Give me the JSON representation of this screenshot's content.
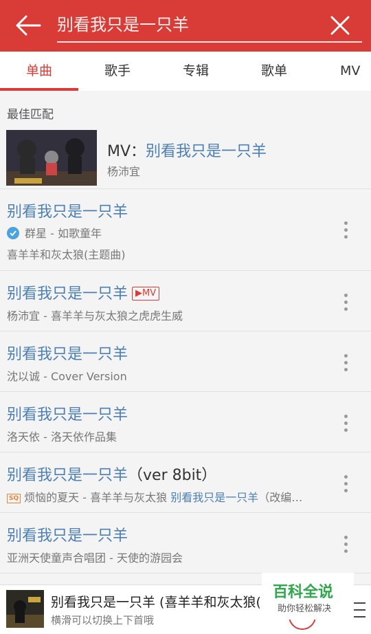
{
  "search": {
    "value": "",
    "placeholder": "别看我只是一只羊"
  },
  "tabs": [
    {
      "label": "单曲",
      "active": true
    },
    {
      "label": "歌手",
      "active": false
    },
    {
      "label": "专辑",
      "active": false
    },
    {
      "label": "歌单",
      "active": false
    },
    {
      "label": "MV",
      "active": false
    }
  ],
  "best_match": {
    "section_title": "最佳匹配",
    "prefix": "MV：",
    "title": "别看我只是一只羊",
    "artist": "杨沛宜"
  },
  "songs": [
    {
      "title": "别看我只是一只羊",
      "line1_prefix": "群星 - ",
      "line1": "如歌童年",
      "line2": "喜羊羊和灰太狼(主题曲)"
    },
    {
      "title": "别看我只是一只羊",
      "badge": "▶MV",
      "sub": "杨沛宜 - 喜羊羊与灰太狼之虎虎生威"
    },
    {
      "title": "别看我只是一只羊",
      "sub": "沈以诚 - Cover Version"
    },
    {
      "title": "别看我只是一只羊",
      "sub": "洛天依 - 洛天依作品集"
    },
    {
      "title": "别看我只是一只羊",
      "title_suffix": "（ver 8bit）",
      "sq_badge": "SQ",
      "sub": "烦恼的夏天 - 喜羊羊与灰太狼 ",
      "sub_highlight": "别看我只是一只羊",
      "sub_tail": "（改编…"
    },
    {
      "title": "别看我只是一只羊",
      "sub": "亚洲天使童声合唱团 - 天使的游园会"
    }
  ],
  "player": {
    "title": "别看我只是一只羊 (喜羊羊和灰太狼(主",
    "subtitle": "横滑可以切换上下首哦"
  },
  "watermark": {
    "title": "百科全说",
    "subtitle": "助你轻松解决"
  },
  "colors": {
    "brand": "#d93c36",
    "link": "#4b7fb6",
    "watermark": "#2ea84a"
  }
}
